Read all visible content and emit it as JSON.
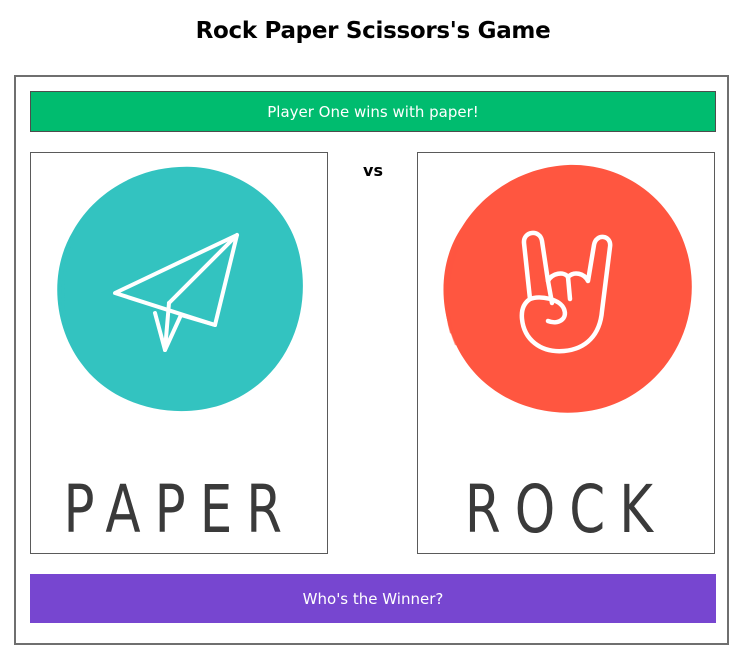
{
  "title": "Rock Paper Scissors's Game",
  "result": {
    "text": "Player One wins with paper!",
    "color": "#00bc6f"
  },
  "player_one": {
    "choice": "PAPER",
    "icon": "paper-plane-icon",
    "circle_color": "#33c3c0"
  },
  "vs_label": "vs",
  "player_two": {
    "choice": "ROCK",
    "icon": "rock-hand-icon",
    "circle_color": "#ff5640"
  },
  "winner_button": {
    "label": "Who's the Winner?",
    "color": "#7746d0"
  }
}
